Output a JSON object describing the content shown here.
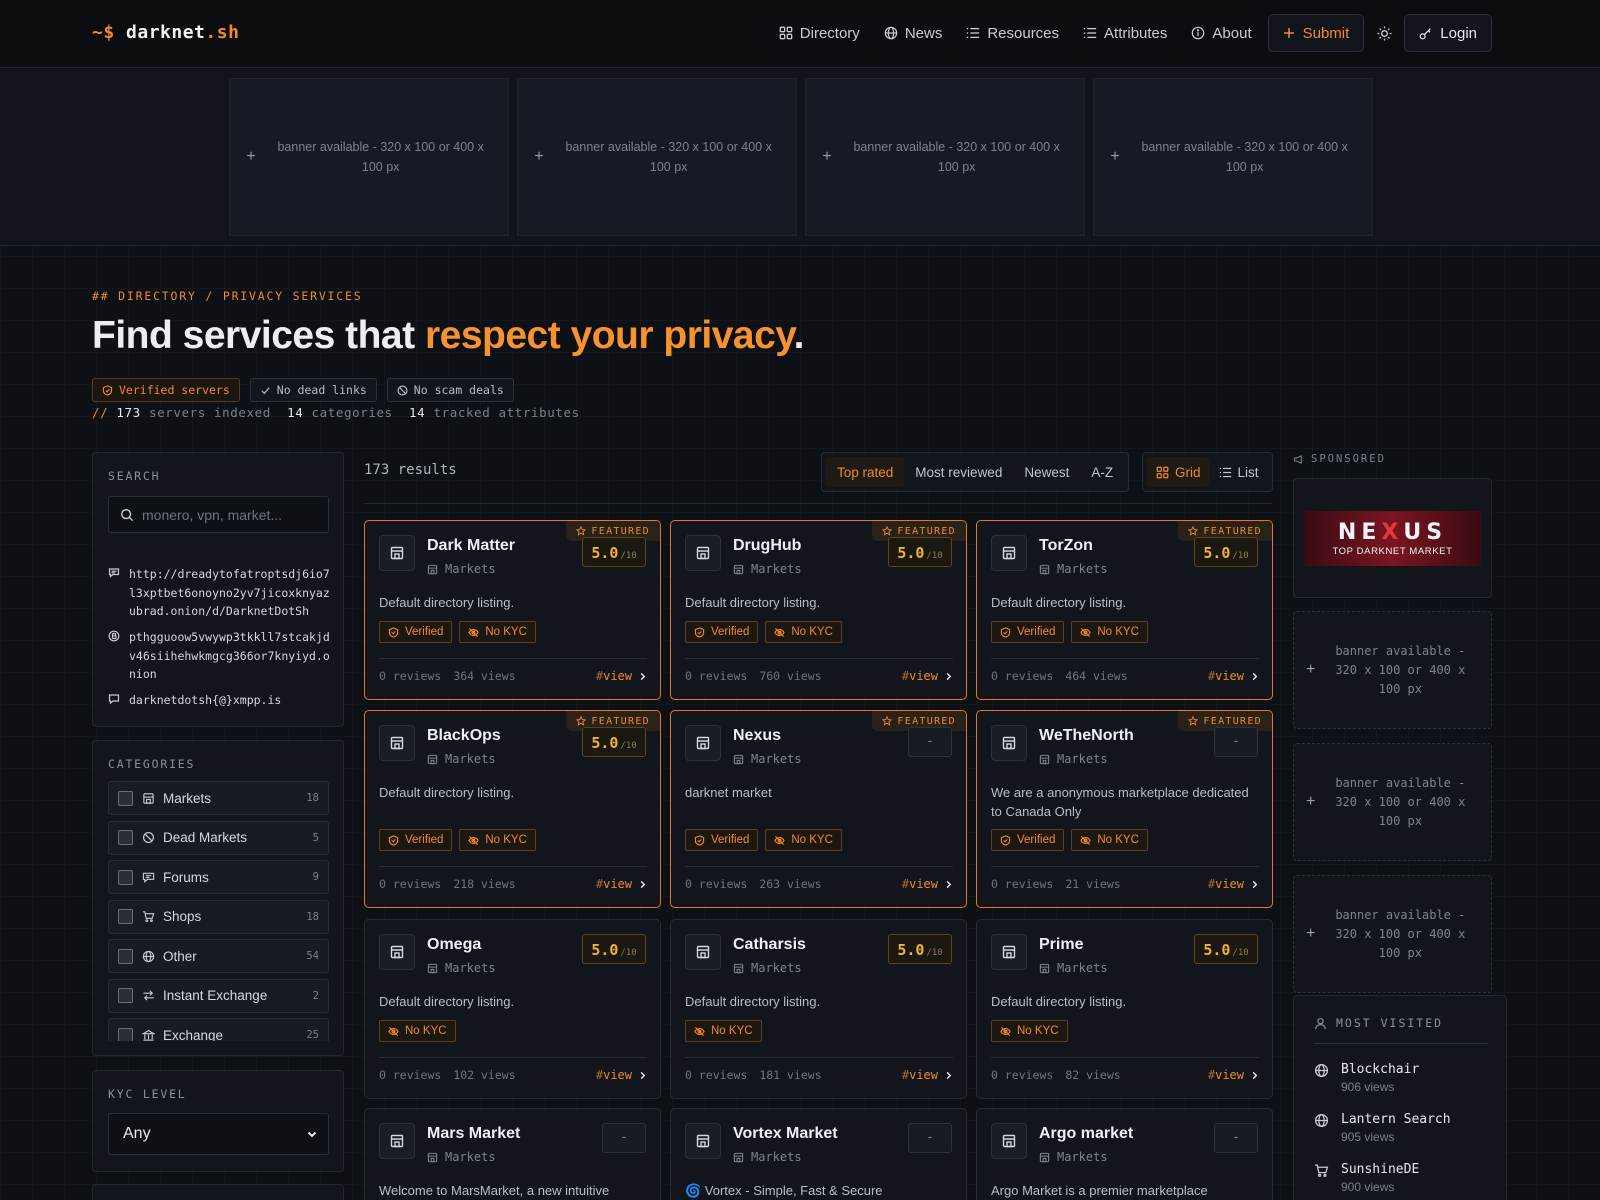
{
  "header": {
    "logo_prompt": "~$",
    "logo_name": "darknet",
    "logo_tld": ".sh",
    "nav": [
      {
        "label": "Directory",
        "icon": "grid-icon"
      },
      {
        "label": "News",
        "icon": "globe-icon"
      },
      {
        "label": "Resources",
        "icon": "list-icon"
      },
      {
        "label": "Attributes",
        "icon": "list-icon"
      },
      {
        "label": "About",
        "icon": "info-icon"
      }
    ],
    "submit_label": "Submit",
    "login_label": "Login"
  },
  "top_banners": [
    "banner available - 320 x 100 or 400 x 100 px",
    "banner available - 320 x 100 or 400 x 100 px",
    "banner available - 320 x 100 or 400 x 100 px",
    "banner available - 320 x 100 or 400 x 100 px"
  ],
  "hero": {
    "crumb": "## DIRECTORY / PRIVACY SERVICES",
    "title_start": "Find services that ",
    "title_accent": "respect your privacy",
    "title_end": ".",
    "badges": [
      "Verified servers",
      "No dead links",
      "No scam deals"
    ],
    "stats_prefix": "//",
    "servers_count": "173",
    "servers_label": "servers indexed",
    "categories_count": "14",
    "categories_label": "categories",
    "attributes_count": "14",
    "attributes_label": "tracked attributes"
  },
  "search": {
    "title": "SEARCH",
    "placeholder": "monero, vpn, market...",
    "contacts": [
      {
        "icon": "forum-icon",
        "value": "http://dreadytofatroptsdj6io7l3xptbet6onoyno2yv7jicoxknyazubrad.onion/d/DarknetDotSh"
      },
      {
        "icon": "bitcoin-icon",
        "value": "pthgguoow5vwywp3tkkll7stcakjdv46siihehwkmgcg366or7knyiyd.onion"
      },
      {
        "icon": "chat-icon",
        "value": "darknetdotsh{@}xmpp.is"
      }
    ]
  },
  "categories": {
    "title": "CATEGORIES",
    "items": [
      {
        "label": "Markets",
        "count": "18",
        "icon": "store-icon"
      },
      {
        "label": "Dead Markets",
        "count": "5",
        "icon": "ban-icon"
      },
      {
        "label": "Forums",
        "count": "9",
        "icon": "forum-icon"
      },
      {
        "label": "Shops",
        "count": "18",
        "icon": "cart-icon"
      },
      {
        "label": "Other",
        "count": "54",
        "icon": "globe-icon"
      },
      {
        "label": "Instant Exchange",
        "count": "2",
        "icon": "exchange-icon"
      },
      {
        "label": "Exchange",
        "count": "25",
        "icon": "bank-icon"
      }
    ]
  },
  "kyc": {
    "title": "KYC LEVEL",
    "selected": "Any"
  },
  "results": {
    "count_label": "173 results",
    "sort_options": [
      "Top rated",
      "Most reviewed",
      "Newest",
      "A-Z"
    ],
    "sort_active": "Top rated",
    "view_options": [
      "Grid",
      "List"
    ],
    "view_active": "Grid"
  },
  "card_labels": {
    "featured": "FEATURED",
    "score_denominator": "/10",
    "view_hash": "#",
    "view_label": "view"
  },
  "cards": [
    {
      "name": "Dark Matter",
      "category": "Markets",
      "score": "5.0",
      "featured": true,
      "desc": "Default directory listing.",
      "tags": [
        "Verified",
        "No KYC"
      ],
      "reviews": "0 reviews",
      "views": "364 views"
    },
    {
      "name": "DrugHub",
      "category": "Markets",
      "score": "5.0",
      "featured": true,
      "desc": "Default directory listing.",
      "tags": [
        "Verified",
        "No KYC"
      ],
      "reviews": "0 reviews",
      "views": "760 views"
    },
    {
      "name": "TorZon",
      "category": "Markets",
      "score": "5.0",
      "featured": true,
      "desc": "Default directory listing.",
      "tags": [
        "Verified",
        "No KYC"
      ],
      "reviews": "0 reviews",
      "views": "464 views"
    },
    {
      "name": "BlackOps",
      "category": "Markets",
      "score": "5.0",
      "featured": true,
      "desc": "Default directory listing.",
      "tags": [
        "Verified",
        "No KYC"
      ],
      "reviews": "0 reviews",
      "views": "218 views"
    },
    {
      "name": "Nexus",
      "category": "Markets",
      "score": "-",
      "featured": true,
      "desc": "darknet market",
      "tags": [
        "Verified",
        "No KYC"
      ],
      "reviews": "0 reviews",
      "views": "263 views"
    },
    {
      "name": "WeTheNorth",
      "category": "Markets",
      "score": "-",
      "featured": true,
      "desc": "We are a anonymous marketplace dedicated to Canada Only",
      "tags": [
        "Verified",
        "No KYC"
      ],
      "reviews": "0 reviews",
      "views": "21 views"
    },
    {
      "name": "Omega",
      "category": "Markets",
      "score": "5.0",
      "featured": false,
      "desc": "Default directory listing.",
      "tags": [
        "No KYC"
      ],
      "reviews": "0 reviews",
      "views": "102 views"
    },
    {
      "name": "Catharsis",
      "category": "Markets",
      "score": "5.0",
      "featured": false,
      "desc": "Default directory listing.",
      "tags": [
        "No KYC"
      ],
      "reviews": "0 reviews",
      "views": "181 views"
    },
    {
      "name": "Prime",
      "category": "Markets",
      "score": "5.0",
      "featured": false,
      "desc": "Default directory listing.",
      "tags": [
        "No KYC"
      ],
      "reviews": "0 reviews",
      "views": "82 views"
    },
    {
      "name": "Mars Market",
      "category": "Markets",
      "score": "-",
      "featured": false,
      "desc": "Welcome to MarsMarket, a new intuitive",
      "tags": [],
      "reviews": "",
      "views": ""
    },
    {
      "name": "Vortex Market",
      "category": "Markets",
      "score": "-",
      "featured": false,
      "desc": "🌀 Vortex - Simple, Fast & Secure",
      "tags": [],
      "reviews": "",
      "views": ""
    },
    {
      "name": "Argo market",
      "category": "Markets",
      "score": "-",
      "featured": false,
      "desc": "Argo Market is a premier marketplace",
      "tags": [],
      "reviews": "",
      "views": ""
    }
  ],
  "sponsored": {
    "label": "SPONSORED",
    "ad_title_a": "NE",
    "ad_title_x": "X",
    "ad_title_b": "US",
    "ad_subtitle": "TOP DARKNET MARKET",
    "banners": [
      "banner available - 320 x 100 or 400 x 100 px",
      "banner available - 320 x 100 or 400 x 100 px",
      "banner available - 320 x 100 or 400 x 100 px"
    ]
  },
  "most_visited": {
    "title": "MOST VISITED",
    "items": [
      {
        "name": "Blockchair",
        "views": "906 views",
        "icon": "globe-icon"
      },
      {
        "name": "Lantern Search",
        "views": "905 views",
        "icon": "globe-icon"
      },
      {
        "name": "SunshineDE",
        "views": "900 views",
        "icon": "cart-icon"
      }
    ]
  },
  "colors": {
    "accent": "#f08a2c",
    "background": "#0d1015",
    "card": "#12161c",
    "score": "#f2b23a"
  }
}
